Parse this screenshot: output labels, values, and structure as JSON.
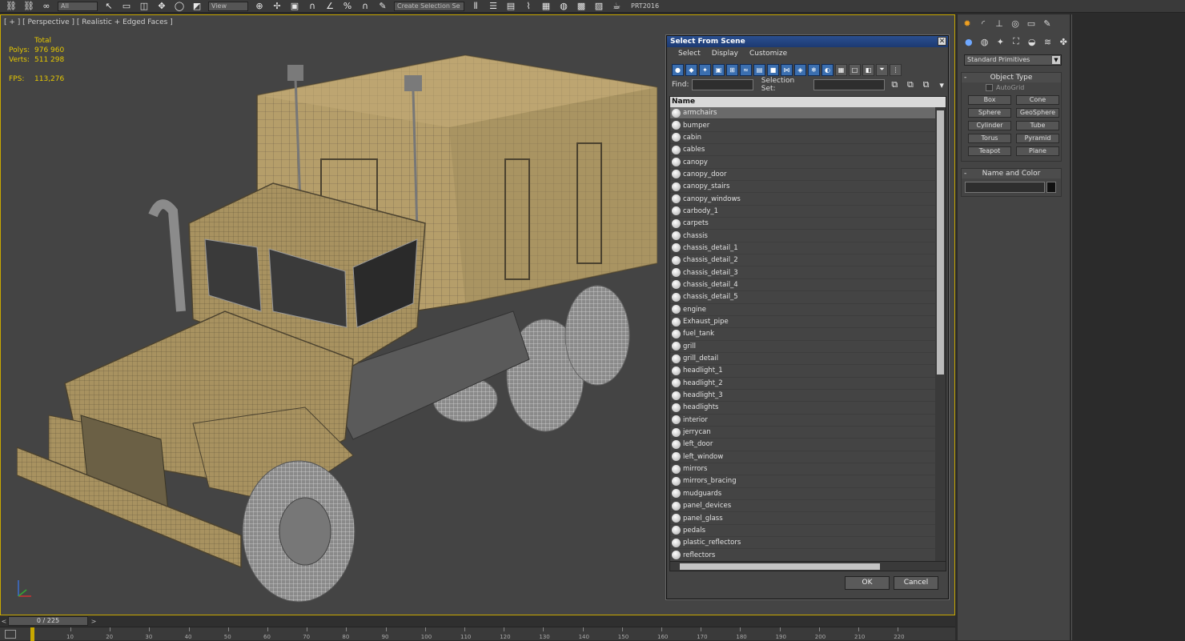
{
  "toolbar": {
    "icons": [
      "link-icon",
      "unlink-icon",
      "bind-icon",
      "select-icon",
      "rect-select-icon",
      "window-crossing-icon",
      "move-icon",
      "rotate-icon",
      "scale-icon",
      "snap-icon",
      "angle-snap-icon",
      "percent-snap-icon",
      "spinner-snap-icon",
      "edit-named-icon",
      "mirror-icon",
      "align-icon",
      "layer-icon",
      "curve-editor-icon",
      "schematic-icon",
      "material-icon",
      "render-setup-icon",
      "render-frame-icon",
      "render-icon"
    ],
    "selection_filter": "All",
    "coord_system": "View",
    "named_selection": "Create Selection Se",
    "label": "PRT2016"
  },
  "viewport": {
    "label": "[ + ] [ Perspective ] [ Realistic + Edged Faces ]",
    "stats": {
      "total_label": "Total",
      "polys_label": "Polys:",
      "polys": "976 960",
      "verts_label": "Verts:",
      "verts": "511 298",
      "fps_label": "FPS:",
      "fps": "113,276"
    }
  },
  "dialog": {
    "title": "Select From Scene",
    "close": "✕",
    "menu": [
      "Select",
      "Display",
      "Customize"
    ],
    "find_label": "Find:",
    "selection_set_label": "Selection Set:",
    "column_header": "Name",
    "items": [
      "armchairs",
      "bumper",
      "cabin",
      "cables",
      "canopy",
      "canopy_door",
      "canopy_stairs",
      "canopy_windows",
      "carbody_1",
      "carpets",
      "chassis",
      "chassis_detail_1",
      "chassis_detail_2",
      "chassis_detail_3",
      "chassis_detail_4",
      "chassis_detail_5",
      "engine",
      "Exhaust_pipe",
      "fuel_tank",
      "grill",
      "grill_detail",
      "headlight_1",
      "headlight_2",
      "headlight_3",
      "headlights",
      "interior",
      "jerrycan",
      "left_door",
      "left_window",
      "mirrors",
      "mirrors_bracing",
      "mudguards",
      "panel_devices",
      "panel_glass",
      "pedals",
      "plastic_reflectors",
      "reflectors"
    ],
    "selected_index": 0,
    "ok_label": "OK",
    "cancel_label": "Cancel"
  },
  "command_panel": {
    "dropdown": "Standard Primitives",
    "object_type_title": "Object Type",
    "autogrid_label": "AutoGrid",
    "primitives": [
      "Box",
      "Cone",
      "Sphere",
      "GeoSphere",
      "Cylinder",
      "Tube",
      "Torus",
      "Pyramid",
      "Teapot",
      "Plane"
    ],
    "name_color_title": "Name and Color",
    "minus": "-"
  },
  "timeline": {
    "frame": "0 / 225",
    "prev": "<",
    "next": ">",
    "ticks": [
      "10",
      "20",
      "30",
      "40",
      "50",
      "60",
      "70",
      "80",
      "90",
      "100",
      "110",
      "120",
      "130",
      "140",
      "150",
      "160",
      "170",
      "180",
      "190",
      "200",
      "210",
      "220"
    ]
  },
  "colors": {
    "accent_yellow": "#c8a800",
    "viewport_bg": "#444444",
    "title_blue": "#2a4f8f"
  }
}
